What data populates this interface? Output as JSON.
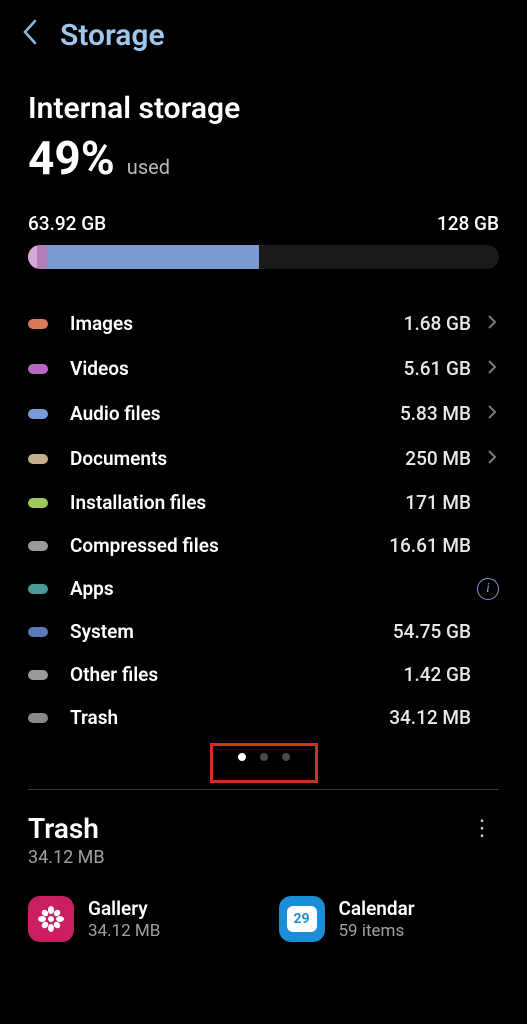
{
  "header": {
    "title": "Storage"
  },
  "internal": {
    "title": "Internal storage",
    "percent": "49%",
    "used_label": "used",
    "used_amount": "63.92 GB",
    "total_amount": "128 GB"
  },
  "categories": [
    {
      "label": "Images",
      "size": "1.68 GB",
      "pill_color": "#d87a5a",
      "has_chevron": true
    },
    {
      "label": "Videos",
      "size": "5.61 GB",
      "pill_color": "#b868c4",
      "has_chevron": true
    },
    {
      "label": "Audio files",
      "size": "5.83 MB",
      "pill_color": "#7a9ad8",
      "has_chevron": true
    },
    {
      "label": "Documents",
      "size": "250 MB",
      "pill_color": "#c4b088",
      "has_chevron": true
    },
    {
      "label": "Installation files",
      "size": "171 MB",
      "pill_color": "#a0c858",
      "has_chevron": false
    },
    {
      "label": "Compressed files",
      "size": "16.61 MB",
      "pill_color": "#9a9a9a",
      "has_chevron": false
    },
    {
      "label": "Apps",
      "size": "",
      "pill_color": "#4a9a9a",
      "has_info": true
    },
    {
      "label": "System",
      "size": "54.75 GB",
      "pill_color": "#5a7ab8",
      "has_chevron": false
    },
    {
      "label": "Other files",
      "size": "1.42 GB",
      "pill_color": "#9a9a9a",
      "has_chevron": false
    },
    {
      "label": "Trash",
      "size": "34.12 MB",
      "pill_color": "#888888",
      "has_chevron": false
    }
  ],
  "pagination": {
    "total": 3,
    "active": 0
  },
  "trash": {
    "title": "Trash",
    "size": "34.12 MB",
    "items": [
      {
        "name": "Gallery",
        "sub": "34.12 MB",
        "icon": "gallery"
      },
      {
        "name": "Calendar",
        "sub": "59 items",
        "icon": "calendar",
        "day": "29"
      }
    ]
  }
}
